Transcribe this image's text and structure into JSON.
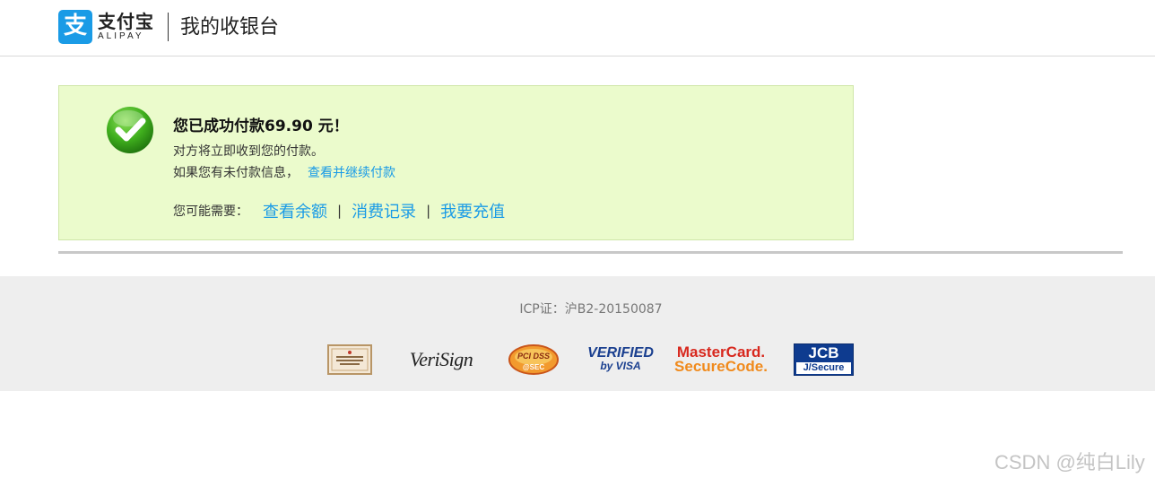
{
  "header": {
    "logo_glyph": "支",
    "logo_cn": "支付宝",
    "logo_en": "ALIPAY",
    "title": "我的收银台"
  },
  "success": {
    "title": "您已成功付款69.90 元！",
    "line1": "对方将立即收到您的付款。",
    "line2_text": "如果您有未付款信息，",
    "line2_link": "查看并继续付款",
    "need_label": "您可能需要：",
    "links": [
      "查看余额",
      "消费记录",
      "我要充值"
    ],
    "separator": "|"
  },
  "footer": {
    "icp": "ICP证：沪B2-20150087",
    "certs": {
      "verisign": "VeriSign",
      "pcidss": "PCI DSS",
      "pcidss_sub": "@SEC",
      "vbv_1": "VERIFIED",
      "vbv_2": "by VISA",
      "mc_1": "MasterCard.",
      "mc_2": "SecureCode.",
      "jcb_1": "JCB",
      "jcb_2": "J/Secure"
    }
  },
  "watermark": "CSDN @纯白Lily",
  "colors": {
    "brand": "#1a9be6",
    "success_bg": "#ebfbcc",
    "footer_bg": "#eeeeee"
  }
}
